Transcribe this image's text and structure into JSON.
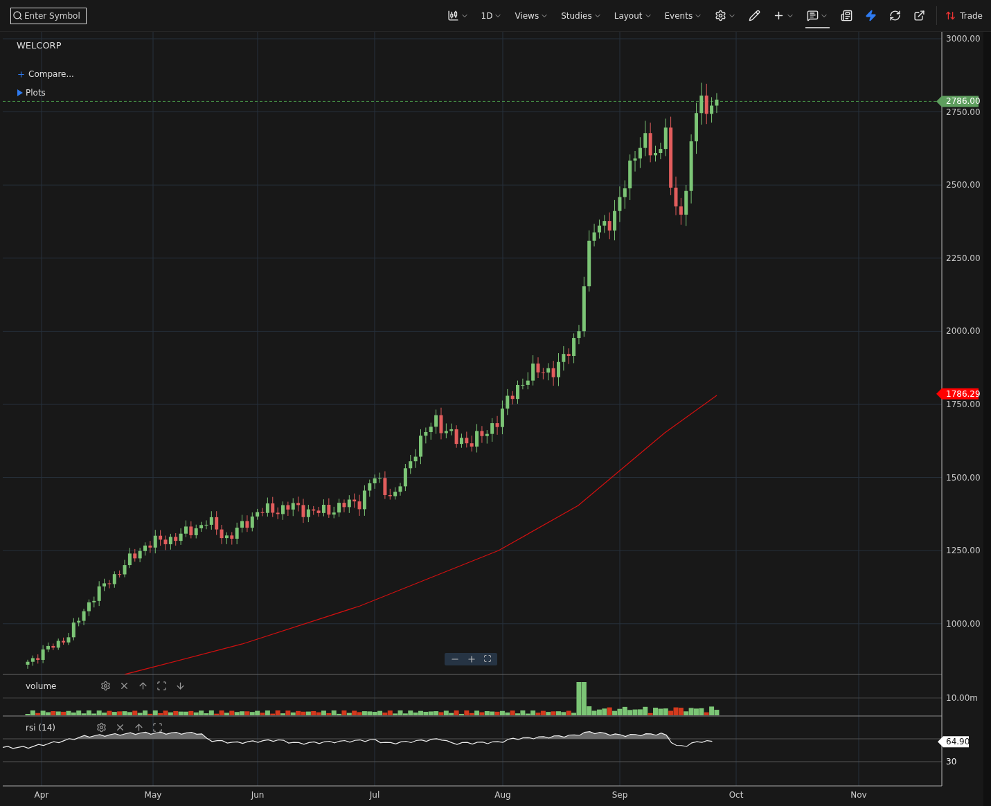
{
  "toolbar": {
    "search": {
      "placeholder": "Enter Symbol"
    },
    "items": [
      {
        "kind": "candles",
        "dropdown": true,
        "selected": false
      },
      {
        "kind": "menu",
        "label": "1D",
        "dropdown": true,
        "selected": false
      },
      {
        "kind": "menu",
        "label": "Views",
        "dropdown": true,
        "selected": false
      },
      {
        "kind": "menu",
        "label": "Studies",
        "dropdown": true,
        "selected": false
      },
      {
        "kind": "menu",
        "label": "Layout",
        "dropdown": true,
        "selected": false
      },
      {
        "kind": "menu",
        "label": "Events",
        "dropdown": true,
        "selected": false
      },
      {
        "kind": "settings",
        "dropdown": true,
        "selected": false
      },
      {
        "kind": "draw",
        "dropdown": false,
        "selected": false
      },
      {
        "kind": "crosshair",
        "dropdown": true,
        "selected": false
      },
      {
        "kind": "comment",
        "dropdown": true,
        "selected": true
      },
      {
        "kind": "table",
        "dropdown": false,
        "selected": false
      },
      {
        "kind": "flash",
        "dropdown": false,
        "selected": false
      },
      {
        "kind": "refresh",
        "dropdown": false,
        "selected": false
      },
      {
        "kind": "popout",
        "dropdown": false,
        "selected": false
      }
    ],
    "trade": "Trade"
  },
  "chart": {
    "symbol": "WELCORP",
    "compare": "Compare...",
    "plots": "Plots",
    "price_axis": [
      "3000.00",
      "2750.00",
      "2500.00",
      "2250.00",
      "2000.00",
      "1750.00",
      "1500.00",
      "1250.00",
      "1000.00"
    ],
    "last_price": "2786.00",
    "moving_average": "1786.29",
    "volume_panel": {
      "title": "volume",
      "axis_label": "10.00m"
    },
    "rsi_panel": {
      "title": "rsi (14)",
      "axis_label": "30",
      "value": "64.90"
    },
    "time_axis": [
      "Apr",
      "May",
      "Jun",
      "Jul",
      "Aug",
      "Sep",
      "Oct",
      "Nov"
    ]
  }
}
